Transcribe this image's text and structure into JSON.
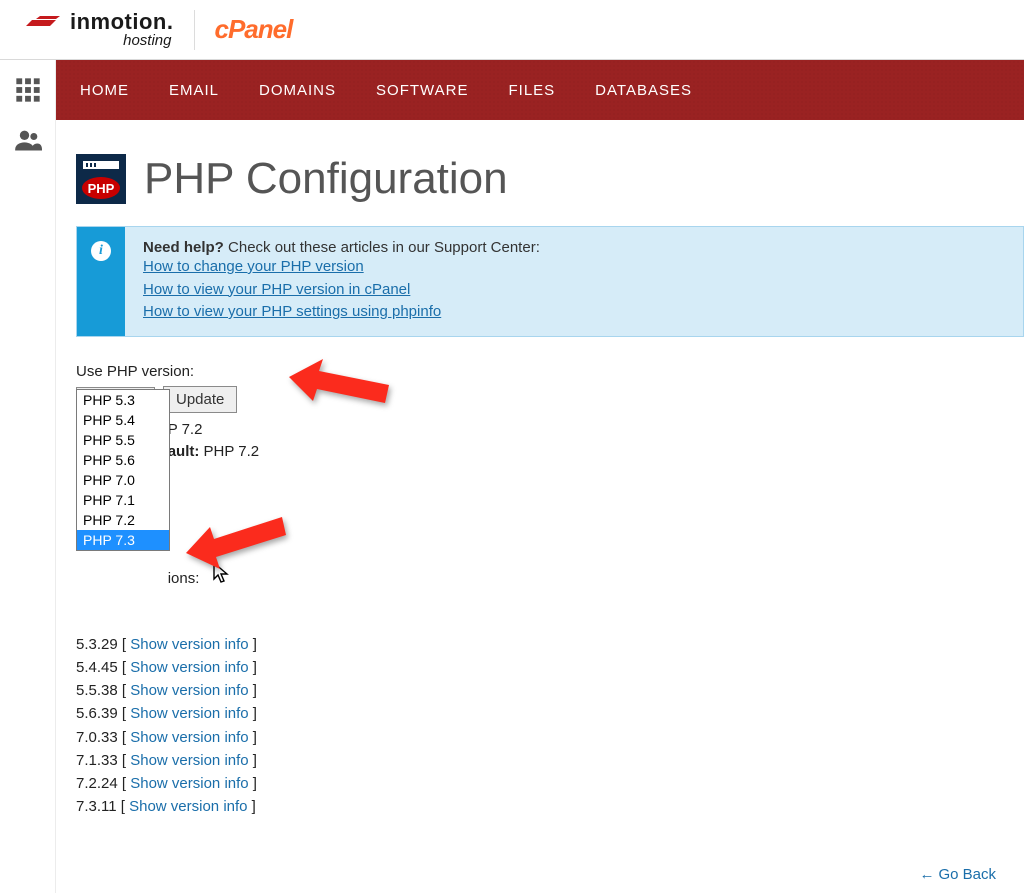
{
  "brand": {
    "inmotion_name": "inmotion",
    "inmotion_sub": "hosting",
    "cpanel": "cPanel"
  },
  "nav": {
    "items": [
      "HOME",
      "EMAIL",
      "DOMAINS",
      "SOFTWARE",
      "FILES",
      "DATABASES"
    ]
  },
  "page": {
    "title": "PHP Configuration"
  },
  "callout": {
    "lead_strong": "Need help?",
    "lead_rest": " Check out these articles in our Support Center:",
    "links": [
      "How to change your PHP version",
      "How to view your PHP version in cPanel",
      "How to view your PHP settings using phpinfo"
    ]
  },
  "form": {
    "label": "Use PHP version:",
    "selected": "PHP 7.2",
    "update_btn": "Update",
    "dropdown_options": [
      "PHP 5.3",
      "PHP 5.4",
      "PHP 5.5",
      "PHP 5.6",
      "PHP 7.0",
      "PHP 7.1",
      "PHP 7.2",
      "PHP 7.3"
    ],
    "dropdown_highlighted": "PHP 7.3",
    "behind_lines": {
      "current_partial": "P 7.2",
      "default_label": "ault:",
      "default_value": " PHP 7.2",
      "ions_partial": "ions:"
    }
  },
  "versions": {
    "title": "Installed PHP Versions:",
    "list": [
      {
        "v": "5.3.29",
        "link": "Show version info"
      },
      {
        "v": "5.4.45",
        "link": "Show version info"
      },
      {
        "v": "5.5.38",
        "link": "Show version info"
      },
      {
        "v": "5.6.39",
        "link": "Show version info"
      },
      {
        "v": "7.0.33",
        "link": "Show version info"
      },
      {
        "v": "7.1.33",
        "link": "Show version info"
      },
      {
        "v": "7.2.24",
        "link": "Show version info"
      },
      {
        "v": "7.3.11",
        "link": "Show version info"
      }
    ]
  },
  "goback": {
    "label": "Go Back"
  }
}
